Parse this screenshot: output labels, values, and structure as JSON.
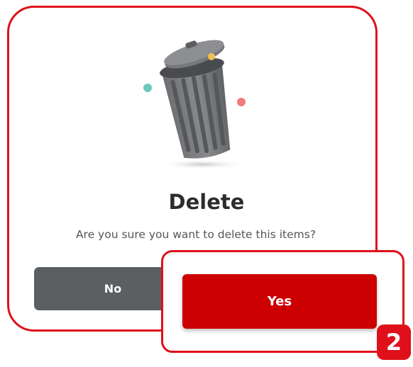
{
  "dialog": {
    "title": "Delete",
    "message": "Are you sure you want to delete this items?",
    "no_label": "No",
    "yes_label": "Yes",
    "illustration_icon": "trash-can-icon"
  },
  "annotation": {
    "step_number": "2"
  },
  "colors": {
    "highlight": "#e0101b",
    "yes_button": "#cc0000",
    "no_button": "#5c5f62",
    "title_text": "#2d2d2d"
  }
}
